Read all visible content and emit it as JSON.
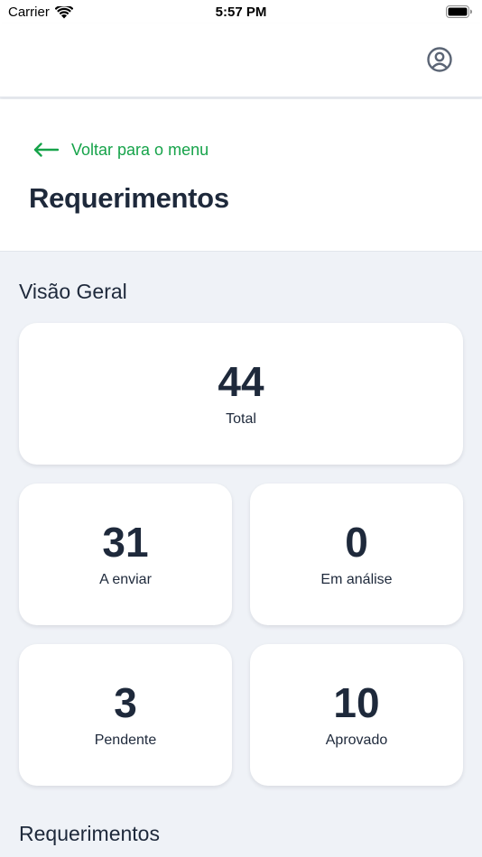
{
  "status_bar": {
    "carrier": "Carrier",
    "time": "5:57 PM"
  },
  "header": {
    "profile_icon": "user-circle-icon"
  },
  "title_section": {
    "back_label": "Voltar para o menu",
    "back_icon": "arrow-left-icon",
    "title": "Requerimentos"
  },
  "overview": {
    "heading": "Visão Geral",
    "total": {
      "value": "44",
      "label": "Total"
    },
    "a_enviar": {
      "value": "31",
      "label": "A enviar"
    },
    "em_analise": {
      "value": "0",
      "label": "Em análise"
    },
    "pendente": {
      "value": "3",
      "label": "Pendente"
    },
    "aprovado": {
      "value": "10",
      "label": "Aprovado"
    }
  },
  "requerimentos_section": {
    "heading": "Requerimentos"
  },
  "colors": {
    "accent": "#16a34a",
    "text": "#1e293b",
    "background": "#eff2f7",
    "card": "#ffffff"
  }
}
